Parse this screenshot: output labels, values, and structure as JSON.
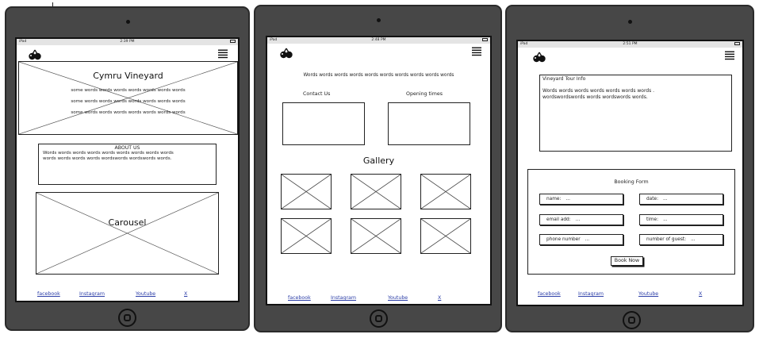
{
  "statusbar": [
    {
      "device": "iPad",
      "time": "2:39 PM"
    },
    {
      "device": "iPad",
      "time": "2:48 PM"
    },
    {
      "device": "iPad",
      "time": "2:51 PM"
    }
  ],
  "home_page": {
    "title": "Cymru Vineyard",
    "hero_lines": [
      "some words words  words  words  words  words  words",
      "some words words  words  words  words  words  words",
      "some words words  words  words  words  words  words"
    ],
    "about_heading": "ABOUT US",
    "about_lines": [
      "Words words words words words words words words  words",
      "words words words  words wordswords  wordswords  words."
    ],
    "carousel_label": "Carousel"
  },
  "gallery_page": {
    "intro": "Words words words words words words words words words words",
    "contact_label": "Contact Us",
    "opening_label": "Opening times",
    "gallery_title": "Gallery"
  },
  "booking_page": {
    "tour_title": "Vineyard Tour Info",
    "tour_lines": [
      "Words words words words words words words .",
      "wordswordswords words wordswords words."
    ],
    "form_title": "Booking Form",
    "fields": {
      "name": {
        "label": "name:",
        "value": "..."
      },
      "date": {
        "label": "date:",
        "value": "..."
      },
      "email": {
        "label": "email add:",
        "value": "..."
      },
      "time": {
        "label": "time:",
        "value": "..."
      },
      "phone": {
        "label": "phone number",
        "value": "..."
      },
      "guests": {
        "label": "number of guest:",
        "value": "..."
      }
    },
    "book_button": "Book Now"
  },
  "footer_links": [
    "facebook",
    "Instagram",
    "Youtube",
    "X"
  ],
  "colors": {
    "frame": "#474747",
    "link": "#2d3fa8",
    "statusbar": "#e4e4e4"
  }
}
